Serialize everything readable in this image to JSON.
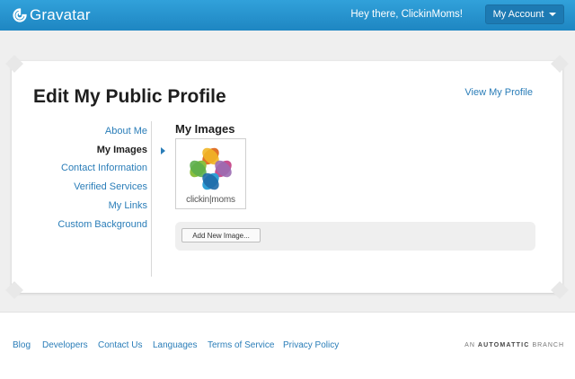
{
  "header": {
    "brand": "Gravatar",
    "greeting": "Hey there, ClickinMoms!",
    "account_button": "My Account",
    "logo_icon": "gravatar-logo-icon",
    "colors": {
      "bar": "#2b95cf",
      "button": "#1d7ab3"
    }
  },
  "main": {
    "title": "Edit My Public Profile",
    "view_profile_link": "View My Profile",
    "nav": [
      {
        "label": "About Me",
        "active": false
      },
      {
        "label": "My Images",
        "active": true
      },
      {
        "label": "Contact Information",
        "active": false
      },
      {
        "label": "Verified Services",
        "active": false
      },
      {
        "label": "My Links",
        "active": false
      },
      {
        "label": "Custom Background",
        "active": false
      }
    ],
    "section_title": "My Images",
    "image": {
      "caption": "clickin|moms"
    },
    "add_button": "Add New Image..."
  },
  "footer": {
    "links": [
      "Blog",
      "Developers",
      "Contact Us",
      "Languages",
      "Terms of Service",
      "Privacy Policy"
    ],
    "branch_prefix": "AN",
    "branch_brand": "AUTOMATTIC",
    "branch_suffix": "BRANCH"
  },
  "colors": {
    "accent": "#2a7db8",
    "page_bg": "#efefef"
  }
}
